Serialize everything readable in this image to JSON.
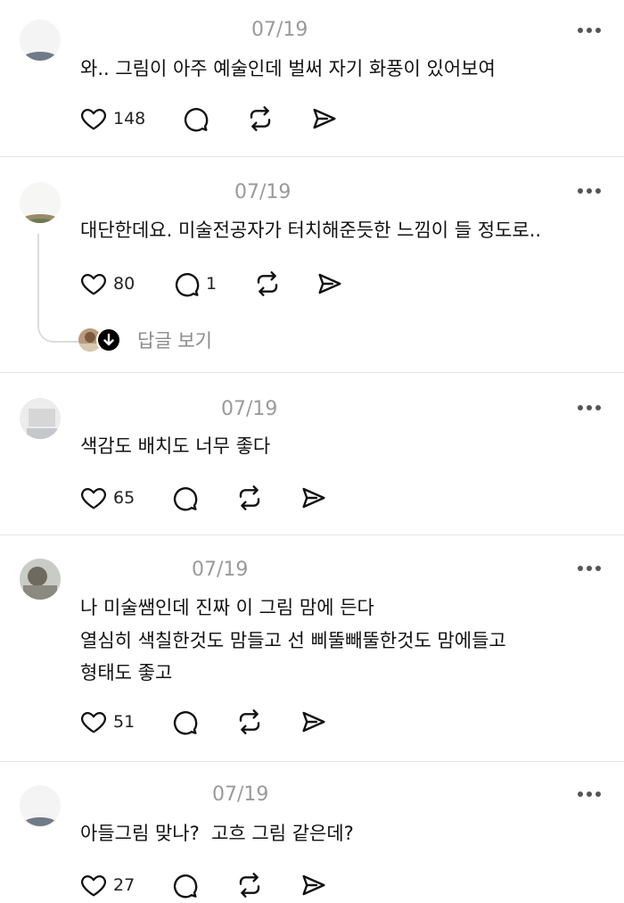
{
  "comments": [
    {
      "date": "07/19",
      "text": "와.. 그림이 아주 예술인데 벌써 자기 화풍이 있어보여",
      "likes": "148",
      "replies": ""
    },
    {
      "date": "07/19",
      "text": "대단한데요. 미술전공자가 터치해준듯한 느낌이 들 정도로..",
      "likes": "80",
      "replies": "1",
      "view_replies_label": "답글 보기"
    },
    {
      "date": "07/19",
      "text": "색감도 배치도 너무 좋다",
      "likes": "65",
      "replies": ""
    },
    {
      "date": "07/19",
      "text_lines": [
        "나 미술쌤인데 진짜 이 그림 맘에 든다",
        "열심히 색칠한것도 맘들고 선 삐뚤빼뚤한것도 맘에들고",
        "형태도 좋고"
      ],
      "likes": "51",
      "replies": ""
    },
    {
      "date": "07/19",
      "text": "아들그림 맞나?  고흐 그림 같은데?",
      "likes": "27",
      "replies": ""
    }
  ],
  "icons": {
    "like": "heart-icon",
    "reply": "comment-bubble-icon",
    "repost": "repost-icon",
    "share": "send-icon",
    "more": "more-dots-icon"
  }
}
